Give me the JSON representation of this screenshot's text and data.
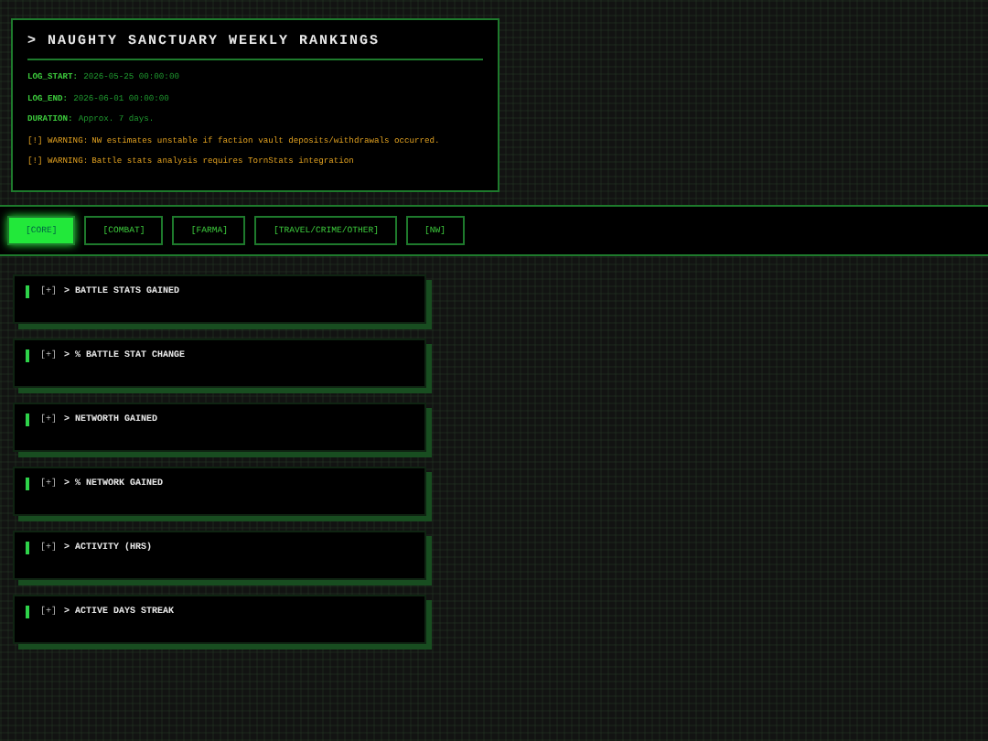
{
  "header": {
    "title": "> NAUGHTY SANCTUARY WEEKLY RANKINGS",
    "fields": [
      {
        "label": "LOG_START:",
        "value": "2026-05-25 00:00:00"
      },
      {
        "label": "LOG_END:",
        "value": "2026-06-01 00:00:00"
      },
      {
        "label": "DURATION:",
        "value": "Approx. 7 days."
      }
    ],
    "warnings": [
      {
        "label": "[!] WARNING:",
        "text": "NW estimates unstable if faction vault deposits/withdrawals occurred."
      },
      {
        "label": "[!] WARNING:",
        "text": "Battle stats analysis requires TornStats integration"
      }
    ]
  },
  "tabs": [
    {
      "label": "[CORE]",
      "selected": true
    },
    {
      "label": "[COMBAT]",
      "selected": false
    },
    {
      "label": "[FARMA]",
      "selected": false
    },
    {
      "label": "[TRAVEL/CRIME/OTHER]",
      "selected": false
    },
    {
      "label": "[NW]",
      "selected": false
    }
  ],
  "sections": [
    {
      "toggle": "[+]",
      "title": "> BATTLE STATS GAINED"
    },
    {
      "toggle": "[+]",
      "title": "> % BATTLE STAT CHANGE"
    },
    {
      "toggle": "[+]",
      "title": "> NETWORTH GAINED"
    },
    {
      "toggle": "[+]",
      "title": "> % NETWORK GAINED"
    },
    {
      "toggle": "[+]",
      "title": "> ACTIVITY (HRS)"
    },
    {
      "toggle": "[+]",
      "title": "> ACTIVE DAYS STREAK"
    }
  ]
}
